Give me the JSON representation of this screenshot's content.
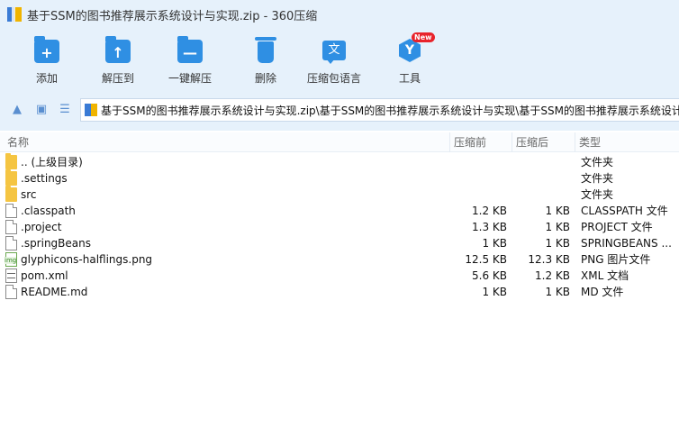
{
  "window": {
    "title": "基于SSM的图书推荐展示系统设计与实现.zip - 360压缩"
  },
  "toolbar": {
    "items": [
      {
        "label": "添加",
        "icon": "add-icon"
      },
      {
        "label": "解压到",
        "icon": "extract-to-icon"
      },
      {
        "label": "一键解压",
        "icon": "one-click-extract-icon"
      },
      {
        "label": "删除",
        "icon": "trash-icon"
      },
      {
        "label": "压缩包语言",
        "icon": "language-icon"
      },
      {
        "label": "工具",
        "icon": "tools-icon",
        "badge": "New"
      }
    ]
  },
  "nav": {
    "address": "基于SSM的图书推荐展示系统设计与实现.zip\\基于SSM的图书推荐展示系统设计与实现\\基于SSM的图书推荐展示系统设计与"
  },
  "columns": {
    "name": "名称",
    "size": "压缩前",
    "packed": "压缩后",
    "type": "类型"
  },
  "files": [
    {
      "name": ".. (上级目录)",
      "size": "",
      "packed": "",
      "type": "文件夹",
      "icon": "folder-icon"
    },
    {
      "name": ".settings",
      "size": "",
      "packed": "",
      "type": "文件夹",
      "icon": "folder-icon"
    },
    {
      "name": "src",
      "size": "",
      "packed": "",
      "type": "文件夹",
      "icon": "folder-icon"
    },
    {
      "name": ".classpath",
      "size": "1.2 KB",
      "packed": "1 KB",
      "type": "CLASSPATH 文件",
      "icon": "file-icon"
    },
    {
      "name": ".project",
      "size": "1.3 KB",
      "packed": "1 KB",
      "type": "PROJECT 文件",
      "icon": "file-icon"
    },
    {
      "name": ".springBeans",
      "size": "1 KB",
      "packed": "1 KB",
      "type": "SPRINGBEANS ...",
      "icon": "file-icon"
    },
    {
      "name": "glyphicons-halflings.png",
      "size": "12.5 KB",
      "packed": "12.3 KB",
      "type": "PNG 图片文件",
      "icon": "image-file-icon"
    },
    {
      "name": "pom.xml",
      "size": "5.6 KB",
      "packed": "1.2 KB",
      "type": "XML 文档",
      "icon": "xml-file-icon"
    },
    {
      "name": "README.md",
      "size": "1 KB",
      "packed": "1 KB",
      "type": "MD 文件",
      "icon": "file-icon"
    }
  ],
  "colors": {
    "toolbar_bg": "#e6f1fb",
    "accent": "#2f8fe3",
    "folder": "#f5c542",
    "badge": "#e8232b"
  }
}
